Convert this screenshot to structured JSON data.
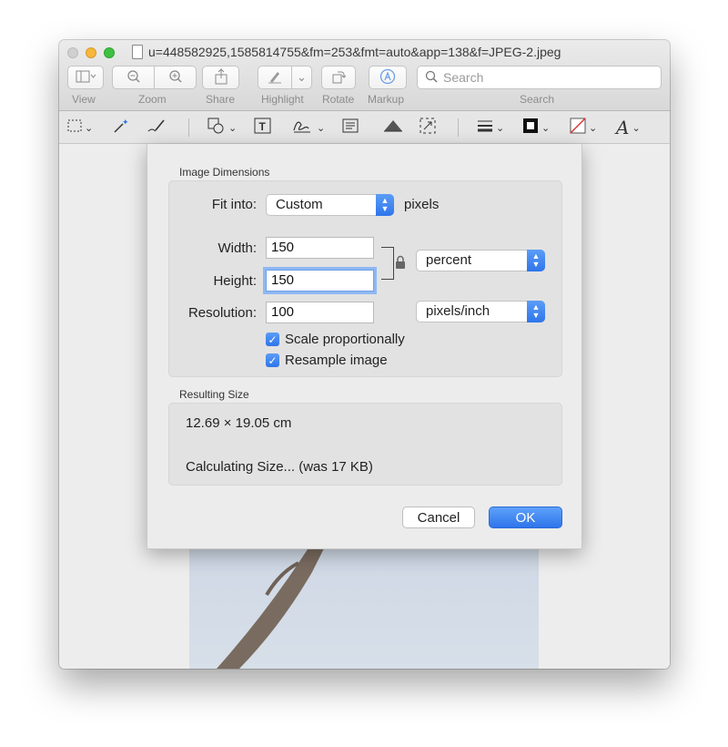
{
  "window": {
    "title": "u=448582925,1585814755&fm=253&fmt=auto&app=138&f=JPEG-2.jpeg"
  },
  "toolbar": {
    "labels": {
      "view": "View",
      "zoom": "Zoom",
      "share": "Share",
      "highlight": "Highlight",
      "rotate": "Rotate",
      "markup": "Markup",
      "search": "Search"
    },
    "search_placeholder": "Search"
  },
  "dialog": {
    "image_dimensions_title": "Image Dimensions",
    "fit_into_label": "Fit into:",
    "fit_into_value": "Custom",
    "fit_into_unit": "pixels",
    "width_label": "Width:",
    "width_value": "150",
    "height_label": "Height:",
    "height_value": "150",
    "size_unit": "percent",
    "resolution_label": "Resolution:",
    "resolution_value": "100",
    "resolution_unit": "pixels/inch",
    "scale_proportionally": "Scale proportionally",
    "scale_checked": true,
    "resample_image": "Resample image",
    "resample_checked": true,
    "resulting_size_title": "Resulting Size",
    "resulting_dimensions": "12.69 × 19.05 cm",
    "resulting_status": "Calculating Size... (was 17 KB)",
    "cancel_label": "Cancel",
    "ok_label": "OK"
  },
  "colors": {
    "accent": "#2f75ea",
    "focus_ring": "#8fb8f3"
  },
  "icons": [
    "sidebar-icon",
    "zoom-out-icon",
    "zoom-in-icon",
    "share-icon",
    "highlight-icon",
    "rotate-icon",
    "markup-icon",
    "search-icon",
    "lock-icon"
  ]
}
